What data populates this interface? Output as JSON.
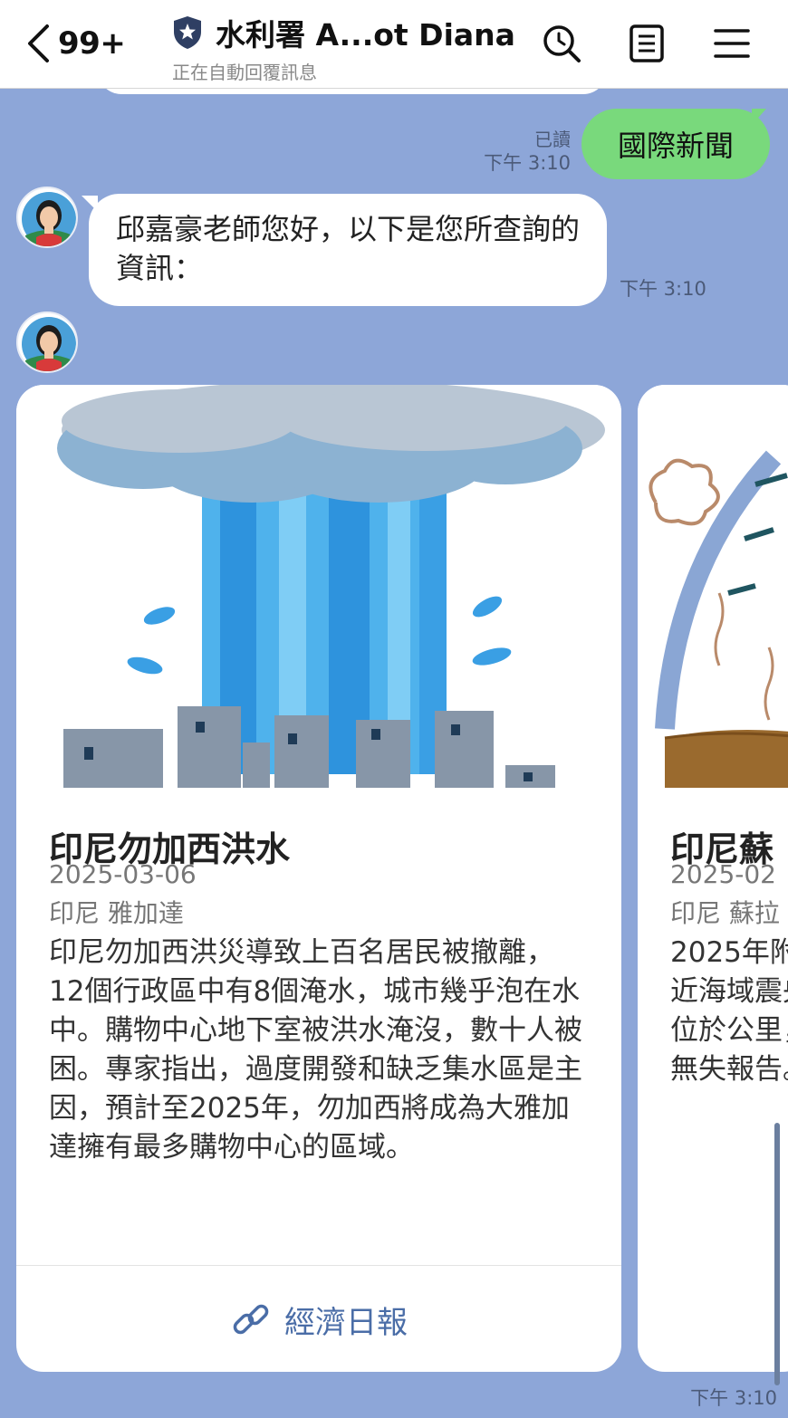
{
  "header": {
    "back_count": "99+",
    "title": "水利署 A...ot Diana",
    "subtitle": "正在自動回覆訊息"
  },
  "messages": {
    "outgoing": {
      "text": "國際新聞",
      "read_label": "已讀",
      "time": "下午 3:10"
    },
    "incoming_text": {
      "text": "邱嘉豪老師您好，以下是您所查詢的資訊：",
      "time": "下午 3:10"
    },
    "carousel_time": "下午 3:10"
  },
  "cards": [
    {
      "title": "印尼勿加西洪水",
      "date": "2025-03-06",
      "location": "印尼 雅加達",
      "description": "印尼勿加西洪災導致上百名居民被撤離，12個行政區中有8個淹水，城市幾乎泡在水中。購物中心地下室被洪水淹沒，數十人被困。專家指出，過度開發和缺乏集水區是主因，預計至2025年，勿加西將成為大雅加達擁有最多購物中心的區域。",
      "link_label": "經濟日報"
    },
    {
      "title": "印尼蘇",
      "date": "2025-02",
      "location": "印尼 蘇拉",
      "description": "2025年附近海域震央位於公里，無失報告。"
    }
  ],
  "icons": {
    "back": "chevron-left-icon",
    "shield": "shield-star-icon",
    "search": "search-icon",
    "notes": "notes-icon",
    "menu": "hamburger-menu-icon",
    "link": "link-icon"
  },
  "colors": {
    "chat_background": "#8da6d8",
    "outgoing_bubble": "#79d97c",
    "link_text": "#4a6da7"
  }
}
